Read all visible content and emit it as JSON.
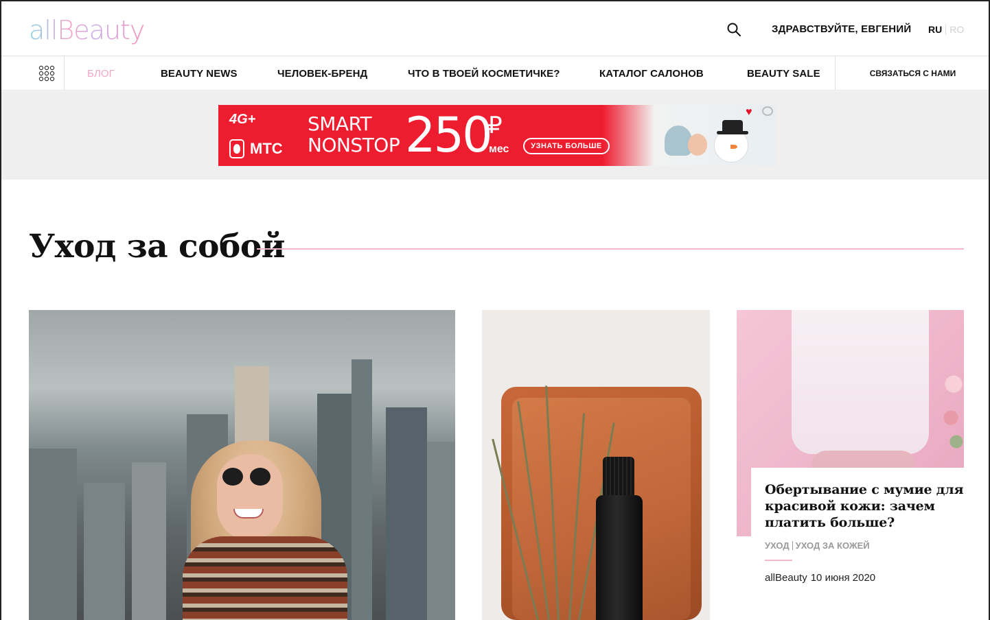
{
  "header": {
    "logo_text": "allBeauty",
    "greeting": "ЗДРАВСТВУЙТЕ, ЕВГЕНИЙ",
    "lang_active": "RU",
    "lang_inactive": "RO"
  },
  "nav": {
    "items": [
      {
        "label": "БЛОГ",
        "active": true
      },
      {
        "label": "BEAUTY NEWS"
      },
      {
        "label": "ЧЕЛОВЕК-БРЕНД"
      },
      {
        "label": "ЧТО В ТВОЕЙ КОСМЕТИЧКЕ?"
      },
      {
        "label": "КАТАЛОГ САЛОНОВ"
      },
      {
        "label": "BEAUTY SALE"
      }
    ],
    "contact_label": "СВЯЗАТЬСЯ С НАМИ"
  },
  "ad": {
    "badge": "4G+",
    "brand": "МТС",
    "line1": "SMART",
    "line2": "NONSTOP",
    "price": "250",
    "currency": "₽",
    "period": "мес",
    "cta": "УЗНАТЬ БОЛЬШЕ"
  },
  "section": {
    "title": "Уход за собой"
  },
  "article": {
    "title": "Обертывание с мумие для красивой кожи: зачем платить больше?",
    "tag1": "УХОД",
    "tag2": "УХОД ЗА КОЖЕЙ",
    "author": "allBeauty",
    "date": "10 июня 2020"
  },
  "colors": {
    "accent": "#f4a6c5",
    "accent_line": "#f3b7d0",
    "ad_red": "#ee1c2f"
  },
  "icons": {
    "search": "search-icon",
    "grid": "grid-menu-icon"
  }
}
